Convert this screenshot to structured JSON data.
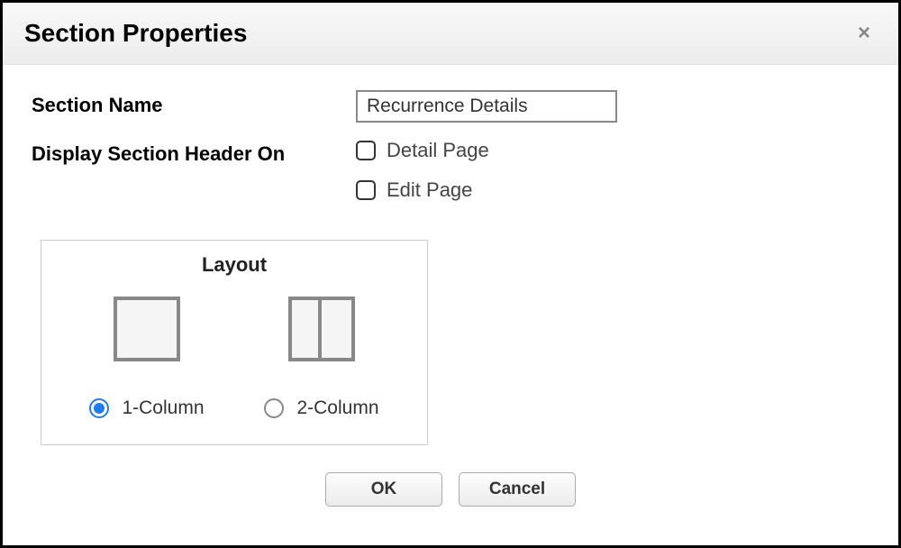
{
  "dialog": {
    "title": "Section Properties",
    "closeIcon": "×"
  },
  "form": {
    "sectionNameLabel": "Section Name",
    "sectionNameValue": "Recurrence Details",
    "displayHeaderLabel": "Display Section Header On",
    "checkboxes": {
      "detailPage": {
        "label": "Detail Page",
        "checked": false
      },
      "editPage": {
        "label": "Edit Page",
        "checked": false
      }
    }
  },
  "layout": {
    "title": "Layout",
    "options": {
      "oneColumn": {
        "label": "1-Column",
        "selected": true
      },
      "twoColumn": {
        "label": "2-Column",
        "selected": false
      }
    }
  },
  "buttons": {
    "ok": "OK",
    "cancel": "Cancel"
  }
}
